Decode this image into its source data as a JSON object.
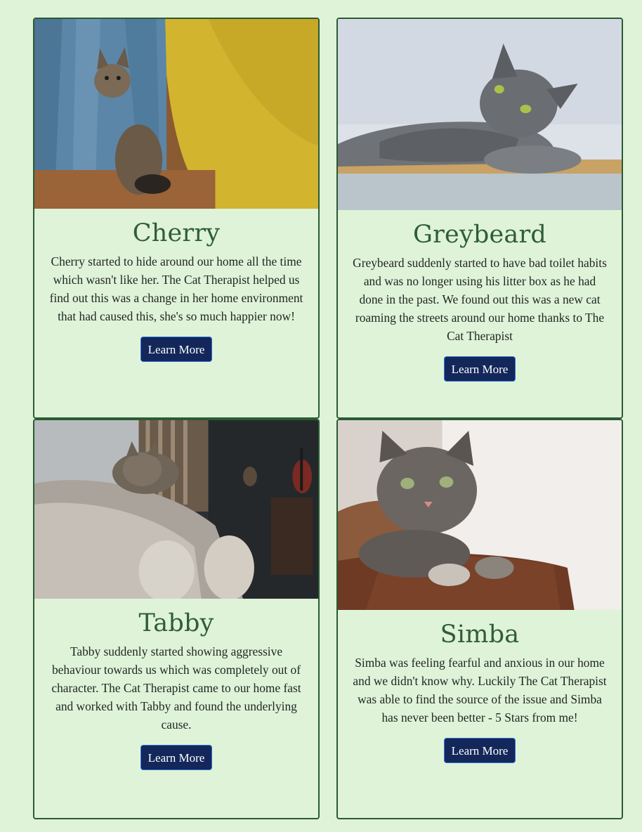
{
  "cards": [
    {
      "name": "Cherry",
      "text": "Cherry started to hide around our home all the time which wasn't like her. The Cat Therapist helped us find out this was a change in her home environment that had caused this, she's so much happier now!",
      "button": "Learn More"
    },
    {
      "name": "Greybeard",
      "text": "Greybeard suddenly started to have bad toilet habits and was no longer using his litter box as he had done in the past. We found out this was a new cat roaming the streets around our home thanks to The Cat Therapist",
      "button": "Learn More"
    },
    {
      "name": "Tabby",
      "text": "Tabby suddenly started showing aggressive behaviour towards us which was completely out of character. The Cat Therapist came to our home fast and worked with Tabby and found the underlying cause.",
      "button": "Learn More"
    },
    {
      "name": "Simba",
      "text": "Simba was feeling fearful and anxious in our home and we didn't know why. Luckily The Cat Therapist was able to find the source of the issue and Simba has never been better - 5 Stars from me!",
      "button": "Learn More"
    }
  ],
  "colors": {
    "page_background": "#dff3d8",
    "card_border": "#2b5a34",
    "heading": "#2f5d36",
    "button_background": "#13275a",
    "button_border": "#2d6fd8"
  }
}
